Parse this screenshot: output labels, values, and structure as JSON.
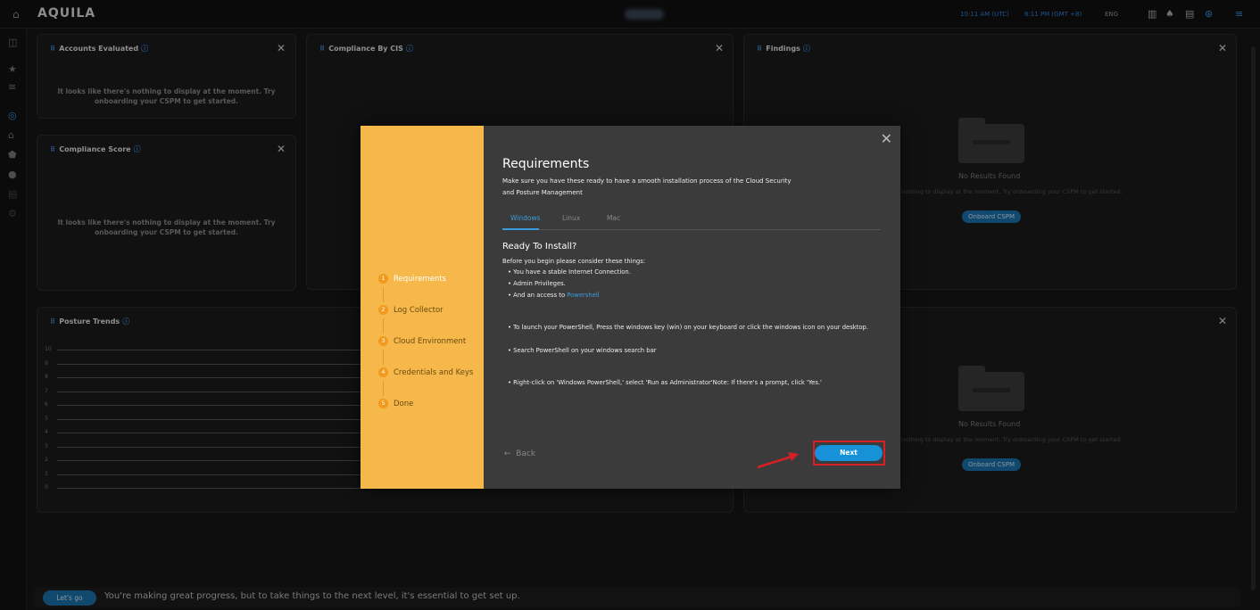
{
  "app": {
    "brand": "AQUILA",
    "time_utc": "10:11 AM (UTC)",
    "time_local": "6:11 PM (GMT +8)",
    "lang": "ENG"
  },
  "colors": {
    "accent": "#1792d8",
    "modal_side": "#f6b84a",
    "highlight": "#d81f26"
  },
  "panels": {
    "accounts": {
      "title": "Accounts Evaluated",
      "empty": "It looks like there's nothing to display at the moment. Try onboarding your CSPM to get started."
    },
    "cis": {
      "title": "Compliance By CIS"
    },
    "findings": {
      "title": "Findings",
      "no_results": "No Results Found",
      "sub": "nothing to display at the moment. Try onboarding your CSPM to get started.",
      "onboard": "Onboard CSPM"
    },
    "score": {
      "title": "Compliance Score",
      "empty": "It looks like there's nothing to display at the moment. Try onboarding your CSPM to get started."
    },
    "trends": {
      "title": "Posture Trends",
      "y_ticks": [
        "10",
        "9",
        "8",
        "7",
        "6",
        "5",
        "4",
        "3",
        "2",
        "1",
        "0"
      ]
    },
    "lower_right": {
      "no_results": "No Results Found",
      "sub": "nothing to display at the moment. Try onboarding your CSPM to get started.",
      "onboard": "Onboard CSPM"
    }
  },
  "modal": {
    "steps": [
      {
        "n": "1",
        "label": "Requirements"
      },
      {
        "n": "2",
        "label": "Log Collector"
      },
      {
        "n": "3",
        "label": "Cloud Environment"
      },
      {
        "n": "4",
        "label": "Credentials and Keys"
      },
      {
        "n": "5",
        "label": "Done"
      }
    ],
    "title": "Requirements",
    "desc": "Make sure you have these ready to have a smooth installation process of the Cloud Security and Posture Management",
    "tabs": [
      "Windows",
      "Linux",
      "Mac"
    ],
    "ready_heading": "Ready To Install?",
    "intro": "Before you begin please consider these things:",
    "reqs": [
      "You have a stable Internet Connection.",
      "Admin Privileges.",
      "And an access to "
    ],
    "powershell_link": "Powershell",
    "instructions": [
      "To launch your PowerShell, Press the windows key (win) on your keyboard or click the windows icon on your desktop.",
      "Search PowerShell on your windows search bar"
    ],
    "instruction3": "Right-click on 'Windows PowerShell,' select 'Run as Administrator'Note: If there's a prompt, click 'Yes.'",
    "back": "Back",
    "next": "Next"
  },
  "bottom": {
    "button": "Let's go",
    "message": "You're making great progress, but to take things to the next level, it's essential to get set up."
  }
}
